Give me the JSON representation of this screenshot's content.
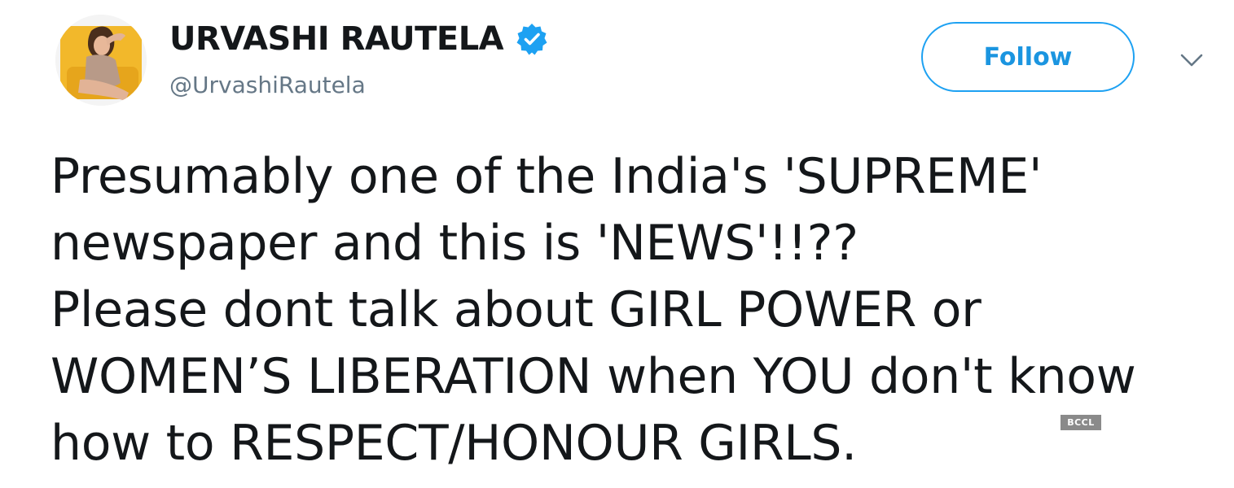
{
  "user": {
    "display_name": "URVASHI RAUTELA",
    "handle": "@UrvashiRautela",
    "verified": true,
    "avatar_icon": "profile-photo"
  },
  "actions": {
    "follow_label": "Follow",
    "more_icon": "chevron-down-icon"
  },
  "tweet": {
    "lines": [
      "Presumably one of the India's 'SUPREME'",
      "newspaper and this is 'NEWS'!!??",
      "Please dont talk about GIRL POWER or",
      "WOMEN’S LIBERATION when YOU don't know",
      "how to RESPECT/HONOUR GIRLS."
    ]
  },
  "watermark": {
    "text": "BCCL"
  },
  "colors": {
    "accent": "#1da1f2",
    "follow_text": "#1b95e0",
    "handle": "#657786",
    "text": "#14171a"
  }
}
